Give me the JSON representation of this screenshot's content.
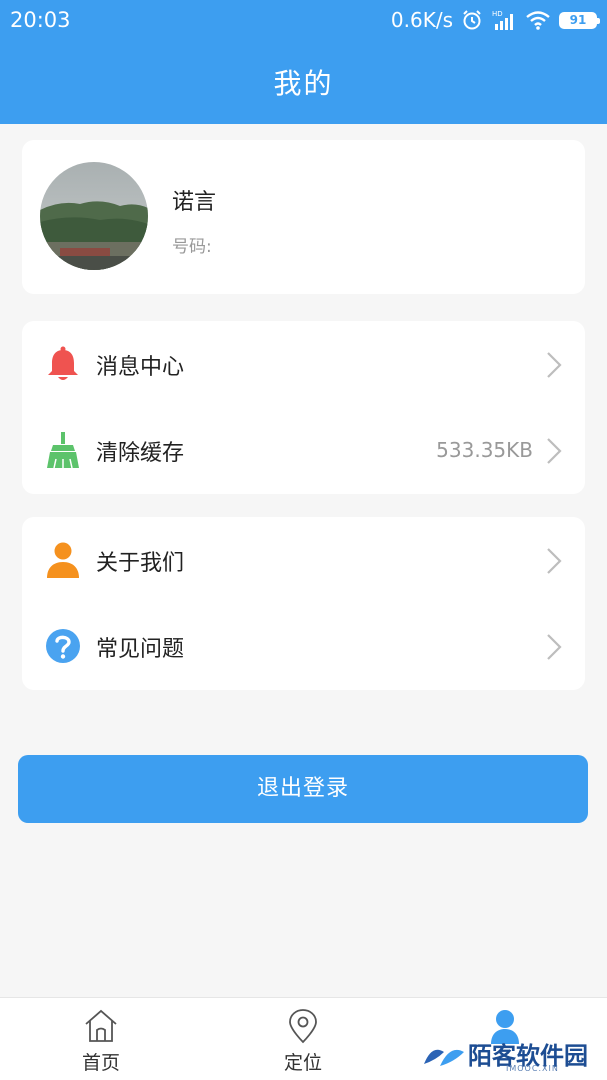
{
  "status_bar": {
    "time": "20:03",
    "speed": "0.6K/s",
    "network_label": "HD",
    "battery": "91"
  },
  "header": {
    "title": "我的"
  },
  "profile": {
    "name": "诺言",
    "phone_label": "号码:"
  },
  "menu_group_1": [
    {
      "label": "消息中心",
      "value": "",
      "icon": "bell-icon",
      "color": "#ef5350"
    },
    {
      "label": "清除缓存",
      "value": "533.35KB",
      "icon": "broom-icon",
      "color": "#5cc36b"
    }
  ],
  "menu_group_2": [
    {
      "label": "关于我们",
      "value": "",
      "icon": "person-icon",
      "color": "#f5911e"
    },
    {
      "label": "常见问题",
      "value": "",
      "icon": "question-icon",
      "color": "#4aa3f0"
    }
  ],
  "logout_label": "退出登录",
  "bottom_nav": {
    "home": "首页",
    "locate": "定位",
    "mine": ""
  },
  "watermark": {
    "text": "陌客软件园",
    "sub": "IMOOC.XIN"
  },
  "colors": {
    "primary": "#3d9ef0",
    "background": "#f6f6f6"
  }
}
